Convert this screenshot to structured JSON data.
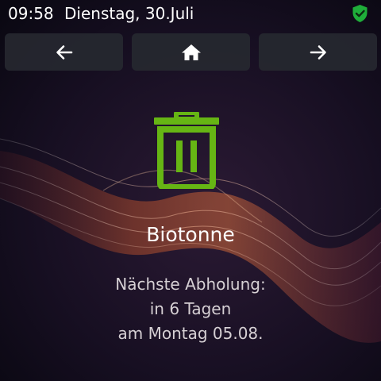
{
  "status": {
    "time": "09:58",
    "date": "Dienstag, 30.Juli",
    "shield_color": "#1fae3a"
  },
  "nav": {
    "back_icon": "arrow-left-icon",
    "home_icon": "home-icon",
    "forward_icon": "arrow-right-icon"
  },
  "bin": {
    "icon": "trash-bin-icon",
    "color": "#66b514",
    "title": "Biotonne"
  },
  "pickup": {
    "line1": "Nächste Abholung:",
    "line2": "in 6 Tagen",
    "line3": "am Montag 05.08."
  }
}
